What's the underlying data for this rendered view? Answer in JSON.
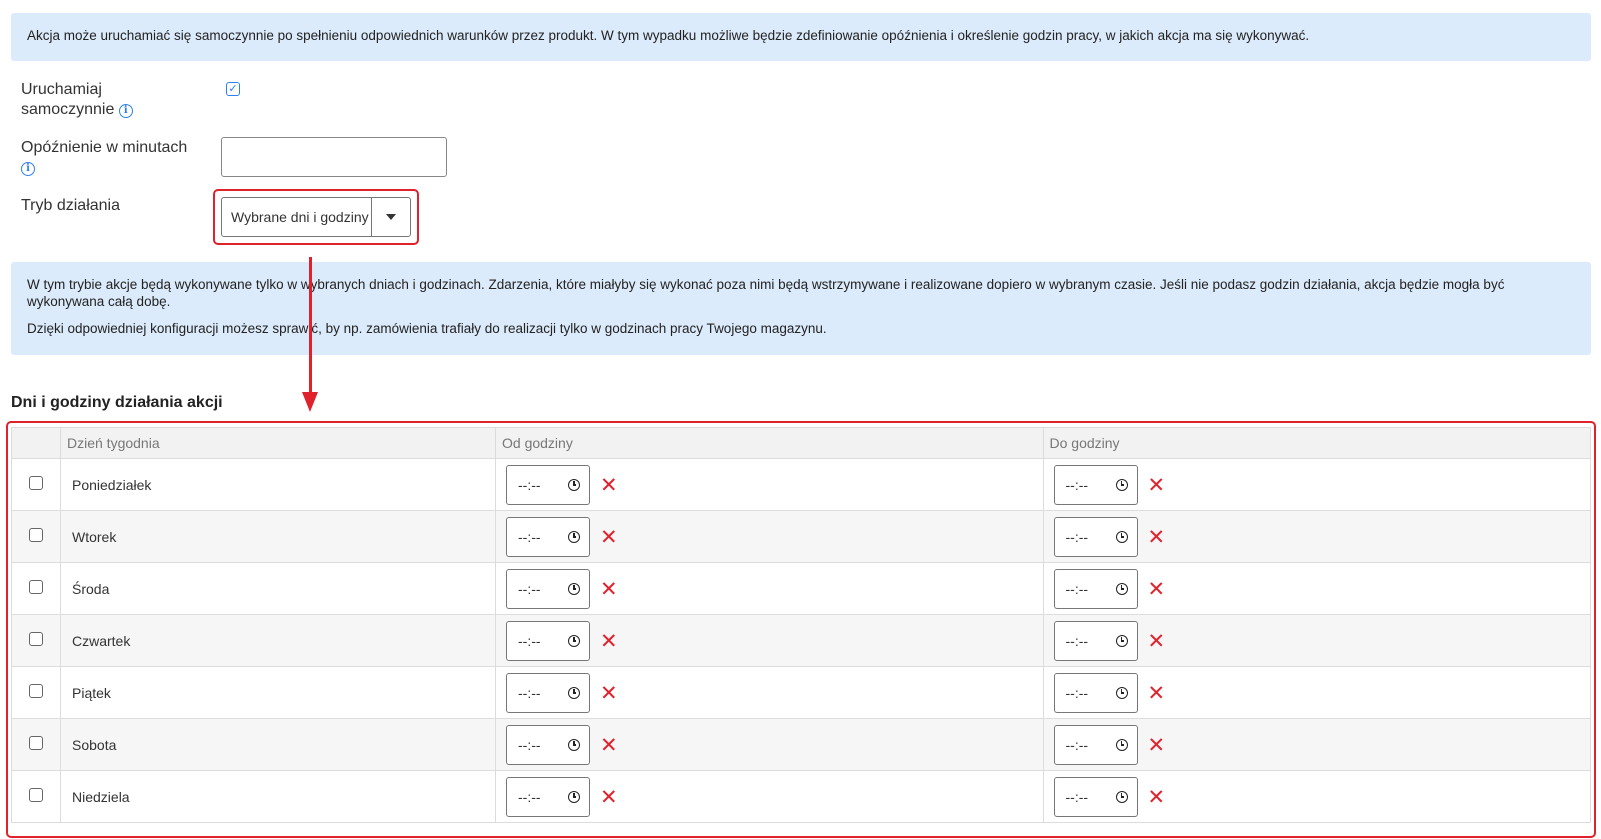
{
  "info_top": "Akcja może uruchamiać się samoczynnie po spełnieniu odpowiednich warunków przez produkt. W tym wypadku możliwe będzie zdefiniowanie opóźnienia i określenie godzin pracy, w jakich akcja ma się wykonywać.",
  "fields": {
    "auto_label_1": "Uruchamiaj",
    "auto_label_2": "samoczynnie",
    "auto_checked": true,
    "delay_label": "Opóźnienie w minutach",
    "delay_value": "",
    "mode_label": "Tryb działania",
    "mode_value": "Wybrane dni i godziny"
  },
  "info_mode": {
    "line1": "W tym trybie akcje będą wykonywane tylko w wybranych dniach i godzinach. Zdarzenia, które miałyby się wykonać poza nimi będą wstrzymywane i realizowane dopiero w wybranym czasie. Jeśli nie podasz godzin działania, akcja będzie mogła być wykonywana całą dobę.",
    "line2": "Dzięki odpowiedniej konfiguracji możesz sprawić, by np. zamówienia trafiały do realizacji tylko w godzinach pracy Twojego magazynu."
  },
  "section_title": "Dni i godziny działania akcji",
  "table": {
    "headers": [
      "",
      "Dzień tygodnia",
      "Od godziny",
      "Do godziny"
    ],
    "time_placeholder": "--:--",
    "rows": [
      {
        "day": "Poniedziałek",
        "from": "--:--",
        "to": "--:--"
      },
      {
        "day": "Wtorek",
        "from": "--:--",
        "to": "--:--"
      },
      {
        "day": "Środa",
        "from": "--:--",
        "to": "--:--"
      },
      {
        "day": "Czwartek",
        "from": "--:--",
        "to": "--:--"
      },
      {
        "day": "Piątek",
        "from": "--:--",
        "to": "--:--"
      },
      {
        "day": "Sobota",
        "from": "--:--",
        "to": "--:--"
      },
      {
        "day": "Niedziela",
        "from": "--:--",
        "to": "--:--"
      }
    ]
  },
  "icons": {
    "info": "info-icon",
    "clear": "close-icon",
    "clock": "clock-icon",
    "dropdown": "chevron-down-icon"
  },
  "colors": {
    "info_bg": "#dcebfb",
    "highlight": "#e0222d",
    "accent": "#2f80ed"
  }
}
